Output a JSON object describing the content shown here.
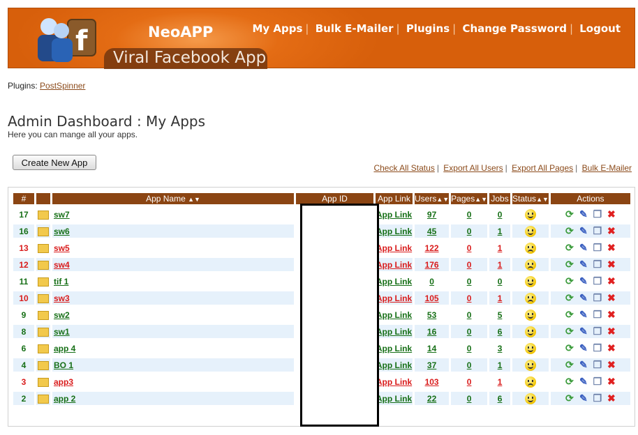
{
  "header": {
    "brand": "NeoAPP",
    "tagline": "Viral Facebook App",
    "nav": [
      "My Apps",
      "Bulk E-Mailer",
      "Plugins",
      "Change Password",
      "Logout"
    ]
  },
  "plugins": {
    "label": "Plugins:",
    "link": "PostSpinner"
  },
  "page": {
    "title": "Admin Dashboard : My Apps",
    "subtitle": "Here you can mange all your apps.",
    "create_button": "Create New App"
  },
  "links": [
    "Check All Status",
    "Export All Users",
    "Export All Pages",
    "Bulk E-Mailer"
  ],
  "table": {
    "headers": [
      "#",
      "",
      "App Name",
      "App ID",
      "App Link",
      "Users",
      "Pages",
      "Jobs",
      "Status",
      "Actions"
    ],
    "rows": [
      {
        "id": "17",
        "name": "sw7",
        "link": "App Link",
        "users": "97",
        "pages": "0",
        "jobs": "0",
        "ok": true
      },
      {
        "id": "16",
        "name": "sw6",
        "link": "App Link",
        "users": "45",
        "pages": "0",
        "jobs": "1",
        "ok": true
      },
      {
        "id": "13",
        "name": "sw5",
        "link": "App Link",
        "users": "122",
        "pages": "0",
        "jobs": "1",
        "ok": false
      },
      {
        "id": "12",
        "name": "sw4",
        "link": "App Link",
        "users": "176",
        "pages": "0",
        "jobs": "1",
        "ok": false
      },
      {
        "id": "11",
        "name": "tif 1",
        "link": "App Link",
        "users": "0",
        "pages": "0",
        "jobs": "0",
        "ok": true
      },
      {
        "id": "10",
        "name": "sw3",
        "link": "App Link",
        "users": "105",
        "pages": "0",
        "jobs": "1",
        "ok": false
      },
      {
        "id": "9",
        "name": "sw2",
        "link": "App Link",
        "users": "53",
        "pages": "0",
        "jobs": "5",
        "ok": true
      },
      {
        "id": "8",
        "name": "sw1",
        "link": "App Link",
        "users": "16",
        "pages": "0",
        "jobs": "6",
        "ok": true
      },
      {
        "id": "6",
        "name": "app 4",
        "link": "App Link",
        "users": "14",
        "pages": "0",
        "jobs": "3",
        "ok": true
      },
      {
        "id": "4",
        "name": "BO 1",
        "link": "App Link",
        "users": "37",
        "pages": "0",
        "jobs": "1",
        "ok": true
      },
      {
        "id": "3",
        "name": "app3",
        "link": "App Link",
        "users": "103",
        "pages": "0",
        "jobs": "1",
        "ok": false
      },
      {
        "id": "2",
        "name": "app 2",
        "link": "App Link",
        "users": "22",
        "pages": "0",
        "jobs": "6",
        "ok": true
      }
    ]
  },
  "colors": {
    "header": "#d75f0b",
    "th": "#8b4513",
    "ok": "#166f16",
    "bad": "#d91b1b",
    "alt_row": "#e6f1fb"
  },
  "icons": {
    "row_icon": "folder-icon",
    "status_ok": "happy-face-icon",
    "status_bad": "sad-face-icon",
    "actions": [
      "refresh-icon",
      "edit-icon",
      "copy-icon",
      "delete-icon"
    ]
  }
}
